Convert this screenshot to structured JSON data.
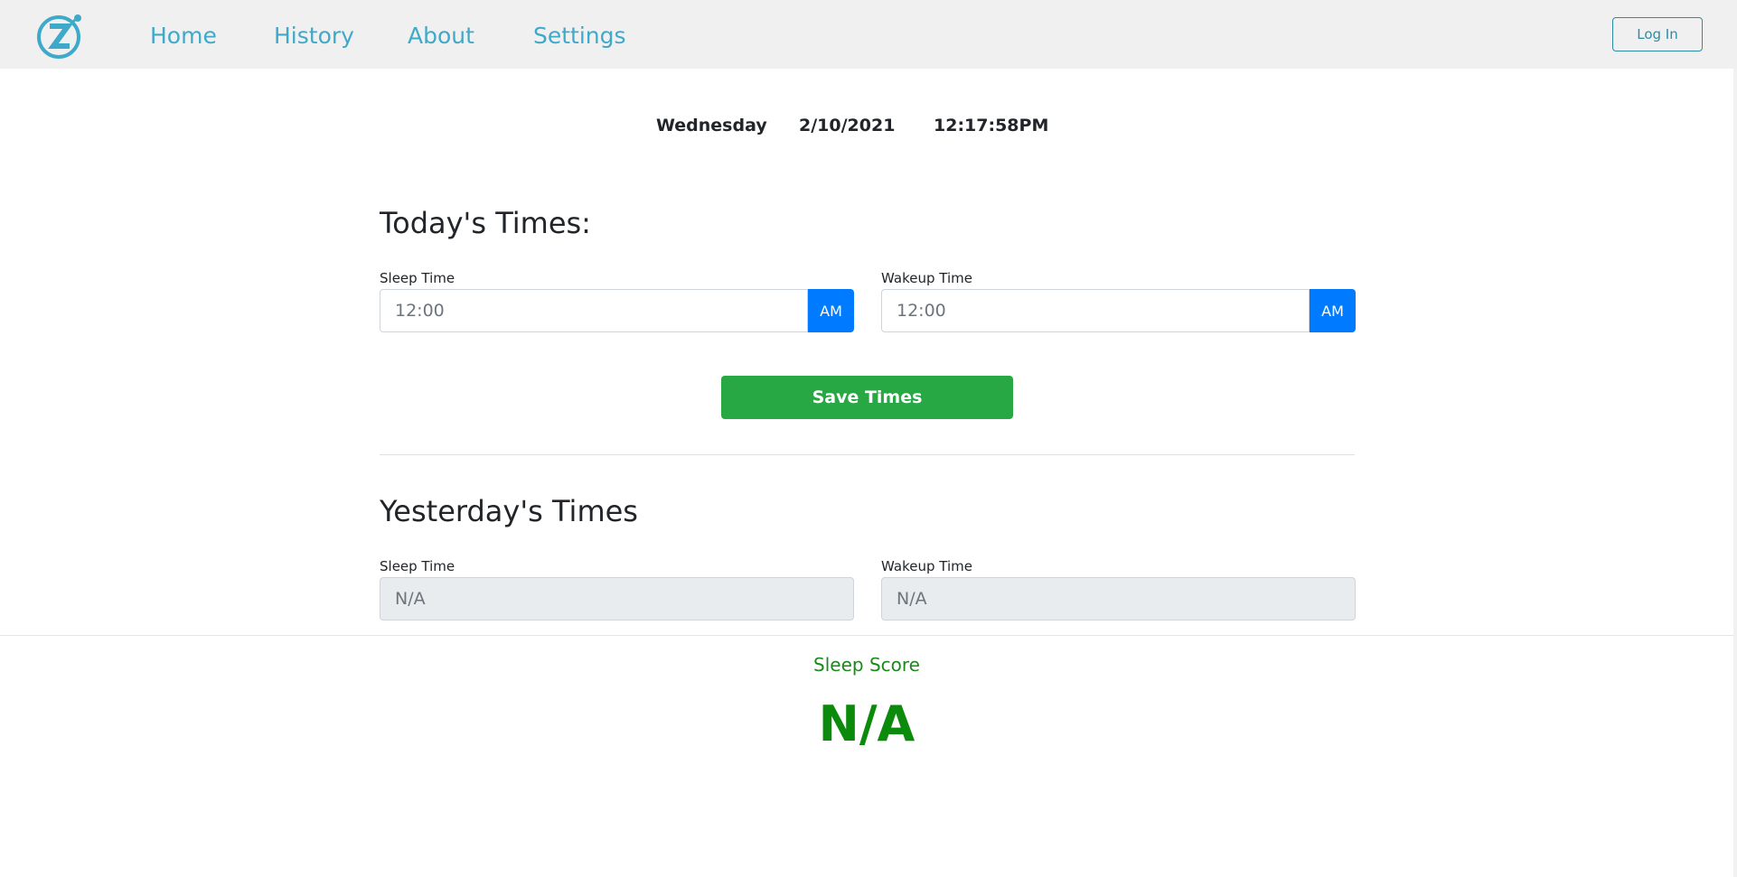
{
  "nav": {
    "items": [
      {
        "label": "Home"
      },
      {
        "label": "History"
      },
      {
        "label": "About"
      },
      {
        "label": "Settings"
      }
    ],
    "login_label": "Log In",
    "logo_icon": "z-stopwatch-logo-icon"
  },
  "datetime": {
    "day": "Wednesday",
    "date": "2/10/2021",
    "time": "12:17:58PM"
  },
  "today": {
    "title": "Today's Times:",
    "sleep": {
      "label": "Sleep Time",
      "placeholder": "12:00",
      "ampm": "AM"
    },
    "wake": {
      "label": "Wakeup Time",
      "placeholder": "12:00",
      "ampm": "AM"
    },
    "save_label": "Save Times"
  },
  "yesterday": {
    "title": "Yesterday's Times",
    "sleep": {
      "label": "Sleep Time",
      "value": "N/A"
    },
    "wake": {
      "label": "Wakeup Time",
      "value": "N/A"
    }
  },
  "score": {
    "label": "Sleep Score",
    "value": "N/A"
  },
  "colors": {
    "nav_link": "#3fa9c9",
    "primary": "#007bff",
    "success": "#28a745",
    "score": "#0b8a0b"
  }
}
